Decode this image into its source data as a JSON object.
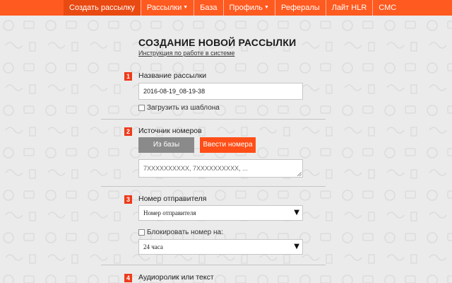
{
  "nav": {
    "items": [
      {
        "label": "Создать рассылку",
        "active": true,
        "caret": false
      },
      {
        "label": "Рассылки",
        "active": false,
        "caret": true
      },
      {
        "label": "База",
        "active": false,
        "caret": false
      },
      {
        "label": "Профиль",
        "active": false,
        "caret": true
      },
      {
        "label": "Рефералы",
        "active": false,
        "caret": false
      },
      {
        "label": "Лайт HLR",
        "active": false,
        "caret": false
      },
      {
        "label": "СМС",
        "active": false,
        "caret": false
      }
    ]
  },
  "header": {
    "title": "СОЗДАНИЕ НОВОЙ РАССЫЛКИ",
    "help_link": "Инструкция по работе в системе"
  },
  "steps": {
    "s1": {
      "number": "1",
      "label": "Название рассылки",
      "input_value": "2016-08-19_08-19-38",
      "checkbox_label": "Загрузить из шаблона"
    },
    "s2": {
      "number": "2",
      "label": "Источник номеров",
      "btn_from_base": "Из базы",
      "btn_enter_numbers": "Ввести номера",
      "textarea_placeholder": "7XXXXXXXXXX, 7XXXXXXXXXX, ..."
    },
    "s3": {
      "number": "3",
      "label": "Номер отправителя",
      "select_value": "Номер отправителя",
      "checkbox_label": "Блокировать номер на:",
      "duration_value": "24 часа"
    },
    "s4": {
      "number": "4",
      "label": "Аудиоролик или текст"
    }
  },
  "colors": {
    "accent": "#ff5a1f",
    "step_badge": "#ee3b1b",
    "secondary_button": "#8a8a8a",
    "background": "#ebebeb"
  }
}
